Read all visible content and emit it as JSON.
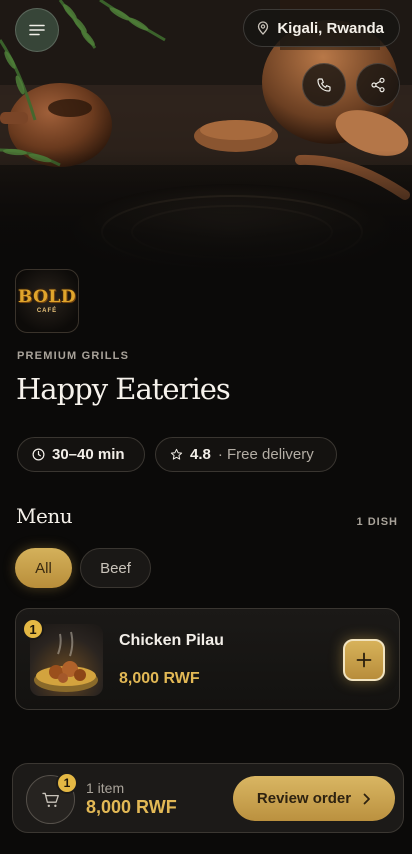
{
  "header": {
    "location": "Kigali, Rwanda",
    "icons": [
      "hamburger-icon",
      "location-pin-icon",
      "phone-icon",
      "share-icon"
    ]
  },
  "restaurant": {
    "logo_text": "BOLD",
    "logo_subtext": "CAFÉ",
    "category": "PREMIUM GRILLS",
    "name": "Happy Eateries",
    "delivery_time": "30–40 min",
    "rating": "4.8",
    "delivery_note": "· Free delivery"
  },
  "menu": {
    "title": "Menu",
    "dish_count": "1 DISH",
    "filters": [
      {
        "label": "All",
        "active": true
      },
      {
        "label": "Beef",
        "active": false
      }
    ],
    "items": [
      {
        "name": "Chicken Pilau",
        "price": "8,000 RWF",
        "quantity": "1"
      }
    ]
  },
  "cart": {
    "badge": "1",
    "item_count": "1 item",
    "total": "8,000 RWF",
    "review_label": "Review order"
  },
  "colors": {
    "accent_gold": "#d4b15b",
    "price_gold": "#e2b855",
    "background": "#0b0a09"
  }
}
